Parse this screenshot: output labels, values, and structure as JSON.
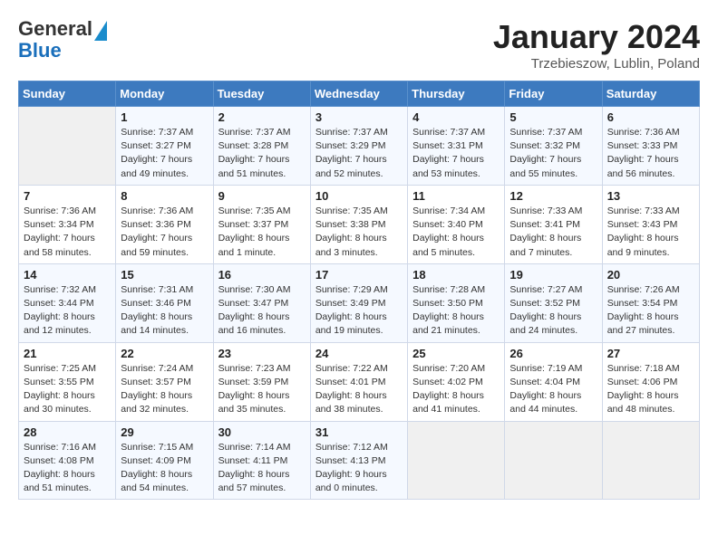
{
  "header": {
    "logo_line1": "General",
    "logo_line2": "Blue",
    "month": "January 2024",
    "location": "Trzebieszow, Lublin, Poland"
  },
  "weekdays": [
    "Sunday",
    "Monday",
    "Tuesday",
    "Wednesday",
    "Thursday",
    "Friday",
    "Saturday"
  ],
  "weeks": [
    [
      {
        "day": "",
        "info": ""
      },
      {
        "day": "1",
        "info": "Sunrise: 7:37 AM\nSunset: 3:27 PM\nDaylight: 7 hours\nand 49 minutes."
      },
      {
        "day": "2",
        "info": "Sunrise: 7:37 AM\nSunset: 3:28 PM\nDaylight: 7 hours\nand 51 minutes."
      },
      {
        "day": "3",
        "info": "Sunrise: 7:37 AM\nSunset: 3:29 PM\nDaylight: 7 hours\nand 52 minutes."
      },
      {
        "day": "4",
        "info": "Sunrise: 7:37 AM\nSunset: 3:31 PM\nDaylight: 7 hours\nand 53 minutes."
      },
      {
        "day": "5",
        "info": "Sunrise: 7:37 AM\nSunset: 3:32 PM\nDaylight: 7 hours\nand 55 minutes."
      },
      {
        "day": "6",
        "info": "Sunrise: 7:36 AM\nSunset: 3:33 PM\nDaylight: 7 hours\nand 56 minutes."
      }
    ],
    [
      {
        "day": "7",
        "info": "Sunrise: 7:36 AM\nSunset: 3:34 PM\nDaylight: 7 hours\nand 58 minutes."
      },
      {
        "day": "8",
        "info": "Sunrise: 7:36 AM\nSunset: 3:36 PM\nDaylight: 7 hours\nand 59 minutes."
      },
      {
        "day": "9",
        "info": "Sunrise: 7:35 AM\nSunset: 3:37 PM\nDaylight: 8 hours\nand 1 minute."
      },
      {
        "day": "10",
        "info": "Sunrise: 7:35 AM\nSunset: 3:38 PM\nDaylight: 8 hours\nand 3 minutes."
      },
      {
        "day": "11",
        "info": "Sunrise: 7:34 AM\nSunset: 3:40 PM\nDaylight: 8 hours\nand 5 minutes."
      },
      {
        "day": "12",
        "info": "Sunrise: 7:33 AM\nSunset: 3:41 PM\nDaylight: 8 hours\nand 7 minutes."
      },
      {
        "day": "13",
        "info": "Sunrise: 7:33 AM\nSunset: 3:43 PM\nDaylight: 8 hours\nand 9 minutes."
      }
    ],
    [
      {
        "day": "14",
        "info": "Sunrise: 7:32 AM\nSunset: 3:44 PM\nDaylight: 8 hours\nand 12 minutes."
      },
      {
        "day": "15",
        "info": "Sunrise: 7:31 AM\nSunset: 3:46 PM\nDaylight: 8 hours\nand 14 minutes."
      },
      {
        "day": "16",
        "info": "Sunrise: 7:30 AM\nSunset: 3:47 PM\nDaylight: 8 hours\nand 16 minutes."
      },
      {
        "day": "17",
        "info": "Sunrise: 7:29 AM\nSunset: 3:49 PM\nDaylight: 8 hours\nand 19 minutes."
      },
      {
        "day": "18",
        "info": "Sunrise: 7:28 AM\nSunset: 3:50 PM\nDaylight: 8 hours\nand 21 minutes."
      },
      {
        "day": "19",
        "info": "Sunrise: 7:27 AM\nSunset: 3:52 PM\nDaylight: 8 hours\nand 24 minutes."
      },
      {
        "day": "20",
        "info": "Sunrise: 7:26 AM\nSunset: 3:54 PM\nDaylight: 8 hours\nand 27 minutes."
      }
    ],
    [
      {
        "day": "21",
        "info": "Sunrise: 7:25 AM\nSunset: 3:55 PM\nDaylight: 8 hours\nand 30 minutes."
      },
      {
        "day": "22",
        "info": "Sunrise: 7:24 AM\nSunset: 3:57 PM\nDaylight: 8 hours\nand 32 minutes."
      },
      {
        "day": "23",
        "info": "Sunrise: 7:23 AM\nSunset: 3:59 PM\nDaylight: 8 hours\nand 35 minutes."
      },
      {
        "day": "24",
        "info": "Sunrise: 7:22 AM\nSunset: 4:01 PM\nDaylight: 8 hours\nand 38 minutes."
      },
      {
        "day": "25",
        "info": "Sunrise: 7:20 AM\nSunset: 4:02 PM\nDaylight: 8 hours\nand 41 minutes."
      },
      {
        "day": "26",
        "info": "Sunrise: 7:19 AM\nSunset: 4:04 PM\nDaylight: 8 hours\nand 44 minutes."
      },
      {
        "day": "27",
        "info": "Sunrise: 7:18 AM\nSunset: 4:06 PM\nDaylight: 8 hours\nand 48 minutes."
      }
    ],
    [
      {
        "day": "28",
        "info": "Sunrise: 7:16 AM\nSunset: 4:08 PM\nDaylight: 8 hours\nand 51 minutes."
      },
      {
        "day": "29",
        "info": "Sunrise: 7:15 AM\nSunset: 4:09 PM\nDaylight: 8 hours\nand 54 minutes."
      },
      {
        "day": "30",
        "info": "Sunrise: 7:14 AM\nSunset: 4:11 PM\nDaylight: 8 hours\nand 57 minutes."
      },
      {
        "day": "31",
        "info": "Sunrise: 7:12 AM\nSunset: 4:13 PM\nDaylight: 9 hours\nand 0 minutes."
      },
      {
        "day": "",
        "info": ""
      },
      {
        "day": "",
        "info": ""
      },
      {
        "day": "",
        "info": ""
      }
    ]
  ]
}
